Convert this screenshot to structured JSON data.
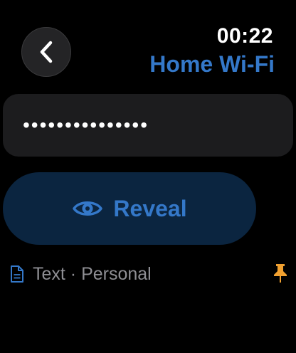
{
  "status": {
    "time": "00:22"
  },
  "header": {
    "title": "Home Wi-Fi",
    "back_icon": "chevron-left-icon"
  },
  "secret": {
    "masked_value": "•••••••••••••••"
  },
  "actions": {
    "reveal_label": "Reveal",
    "reveal_icon": "eye-icon"
  },
  "meta": {
    "type_label": "Text · Personal",
    "type_icon": "document-icon",
    "pinned_icon": "pin-icon"
  },
  "colors": {
    "accent": "#3478c9",
    "reveal_background": "#0b2540",
    "field_background": "#1c1c1e",
    "secondary_text": "#8e8e93",
    "pin": "#f0a030"
  }
}
